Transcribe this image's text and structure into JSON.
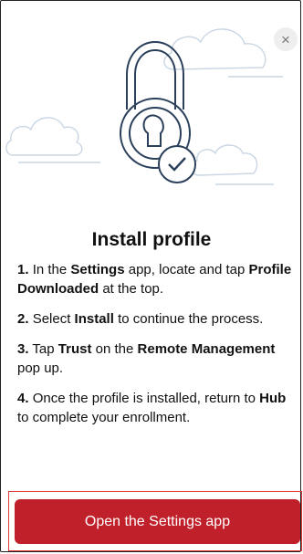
{
  "close_label": "×",
  "title": "Install profile",
  "steps": [
    {
      "num": "1.",
      "parts": [
        "In the ",
        "Settings",
        " app, locate and tap ",
        "Profile Downloaded",
        " at the top."
      ]
    },
    {
      "num": "2.",
      "parts": [
        "Select ",
        "Install",
        " to continue the process."
      ]
    },
    {
      "num": "3.",
      "parts": [
        "Tap ",
        "Trust",
        " on the ",
        "Remote Management",
        " pop up."
      ]
    },
    {
      "num": "4.",
      "parts": [
        "Once the profile is installed, return to ",
        "Hub",
        " to complete your enrollment."
      ]
    }
  ],
  "cta_label": "Open the Settings app",
  "colors": {
    "accent": "#c0202a",
    "illustration_stroke": "#2a3f5a",
    "cloud": "#c9d6e4"
  },
  "icons": [
    "close-icon",
    "padlock-check-illustration"
  ]
}
